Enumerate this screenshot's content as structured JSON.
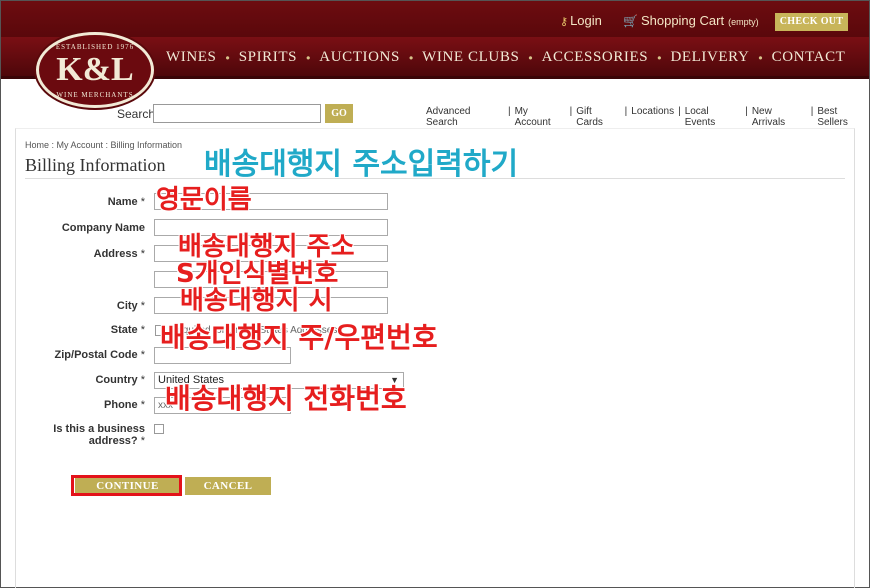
{
  "header": {
    "login": "Login",
    "shopping_cart": "Shopping Cart",
    "cart_status": "(empty)",
    "checkout": "CHECK OUT",
    "logo_top": "ESTABLISHED 1976",
    "logo_mark": "K&L",
    "logo_bottom": "WINE MERCHANTS",
    "nav": [
      "WINES",
      "SPIRITS",
      "AUCTIONS",
      "WINE CLUBS",
      "ACCESSORIES",
      "DELIVERY",
      "CONTACT"
    ]
  },
  "search": {
    "label": "Search",
    "go": "GO",
    "links": [
      "Advanced Search",
      "My Account",
      "Gift Cards",
      "Locations",
      "Local Events",
      "New Arrivals",
      "Best Sellers"
    ]
  },
  "breadcrumb": "Home :  My Account : Billing Information",
  "page_title": "Billing Information",
  "form": {
    "name_label": "Name",
    "company_label": "Company Name",
    "address_label": "Address",
    "city_label": "City",
    "state_label": "State",
    "state_hint": "Required for United States Addresses",
    "zip_label": "Zip/Postal Code",
    "country_label": "Country",
    "country_value": "United States",
    "phone_label": "Phone",
    "phone_value": "xxx",
    "business_label_1": "Is this a business",
    "business_label_2": "address?",
    "required_mark": "*",
    "continue": "CONTINUE",
    "cancel": "CANCEL"
  },
  "annotations": {
    "title": "배송대행지 주소입력하기",
    "name": "영문이름",
    "address": "배송대행지 주소",
    "address2": "S개인식별번호",
    "city": "배송대행지 시",
    "state_zip": "배송대행지 주/우편번호",
    "phone": "배송대행지 전화번호"
  },
  "colors": {
    "header_bg": "#6d0c10",
    "button_gold": "#bfae54",
    "annotation_red": "#e61e1e",
    "annotation_cyan": "#20a9c8",
    "highlight": "#e3121a"
  }
}
